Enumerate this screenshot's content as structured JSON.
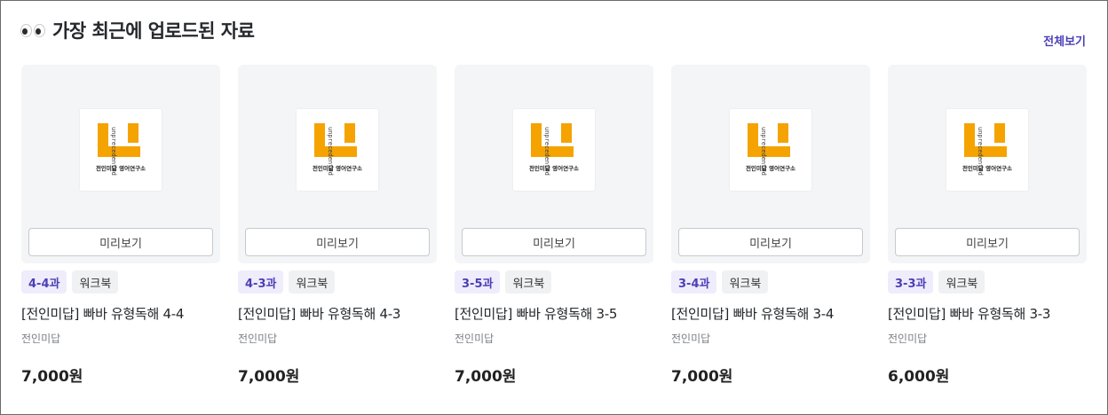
{
  "header": {
    "title": "가장 최근에 업로드된 자료",
    "view_all": "전체보기"
  },
  "brand": {
    "logo_text_vertical": "unprecedented",
    "logo_caption": "전인미답 영어연구소",
    "accent_color": "#f5a300"
  },
  "cards": [
    {
      "lesson": "4-4과",
      "type": "워크북",
      "name": "[전인미답] 빠바 유형독해 4-4",
      "author": "전인미답",
      "price": "7,000원",
      "preview": "미리보기"
    },
    {
      "lesson": "4-3과",
      "type": "워크북",
      "name": "[전인미답] 빠바 유형독해 4-3",
      "author": "전인미답",
      "price": "7,000원",
      "preview": "미리보기"
    },
    {
      "lesson": "3-5과",
      "type": "워크북",
      "name": "[전인미답] 빠바 유형독해 3-5",
      "author": "전인미답",
      "price": "7,000원",
      "preview": "미리보기"
    },
    {
      "lesson": "3-4과",
      "type": "워크북",
      "name": "[전인미답] 빠바 유형독해 3-4",
      "author": "전인미답",
      "price": "7,000원",
      "preview": "미리보기"
    },
    {
      "lesson": "3-3과",
      "type": "워크북",
      "name": "[전인미답] 빠바 유형독해 3-3",
      "author": "전인미답",
      "price": "6,000원",
      "preview": "미리보기"
    }
  ]
}
